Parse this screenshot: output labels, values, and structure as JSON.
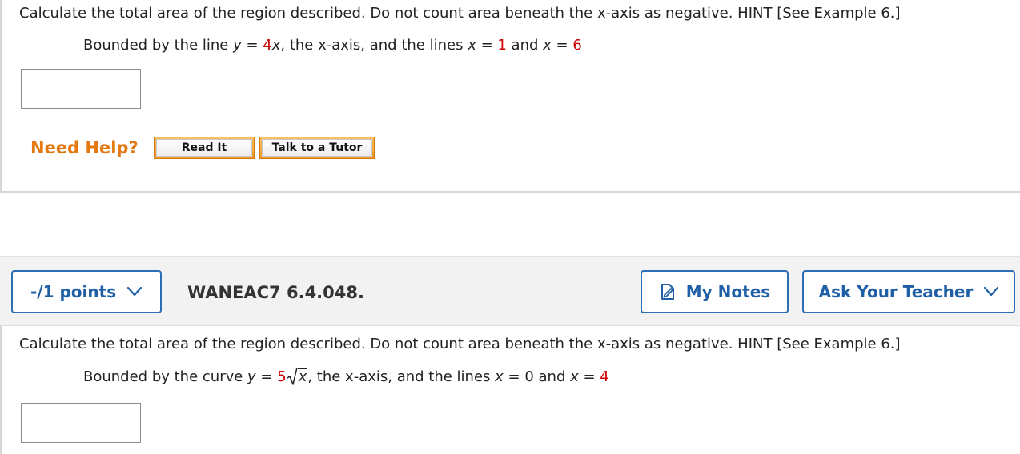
{
  "question1": {
    "prompt": "Calculate the total area of the region described. Do not count area beneath the x-axis as negative. HINT [See Example 6.]",
    "sub_prefix": "Bounded by the line ",
    "y_var": "y",
    "eq_sign": " = ",
    "coef": "4",
    "x_var": "x",
    "sub_mid": ", the x-axis, and the lines ",
    "x_var2": "x",
    "eq_sign2": " = ",
    "lower": "1",
    "and_text": " and ",
    "x_var3": "x",
    "eq_sign3": " = ",
    "upper": "6",
    "answer_value": "",
    "need_help": "Need Help?",
    "read_it": "Read It",
    "talk_tutor": "Talk to a Tutor"
  },
  "question2_header": {
    "points": "-/1 points",
    "question_id": "WANEAC7 6.4.048.",
    "my_notes": "My Notes",
    "ask_teacher": "Ask Your Teacher"
  },
  "question2": {
    "prompt": "Calculate the total area of the region described. Do not count area beneath the x-axis as negative. HINT [See Example 6.]",
    "sub_prefix": "Bounded by the curve ",
    "y_var": "y",
    "eq_sign": " = ",
    "coef": "5",
    "radicand": "x",
    "sub_mid": ", the x-axis, and the lines ",
    "x_var2": "x",
    "eq_sign2": " = ",
    "lower": "0",
    "and_text": " and ",
    "x_var3": "x",
    "eq_sign3": " = ",
    "upper": "4",
    "answer_value": ""
  },
  "colors": {
    "accent_blue": "#1f5fa5",
    "help_orange": "#e47911",
    "value_red": "#cc0000"
  },
  "icons": {
    "points_dropdown": "chevron-down-icon",
    "notes": "notes-icon",
    "ask_dropdown": "chevron-down-icon"
  }
}
